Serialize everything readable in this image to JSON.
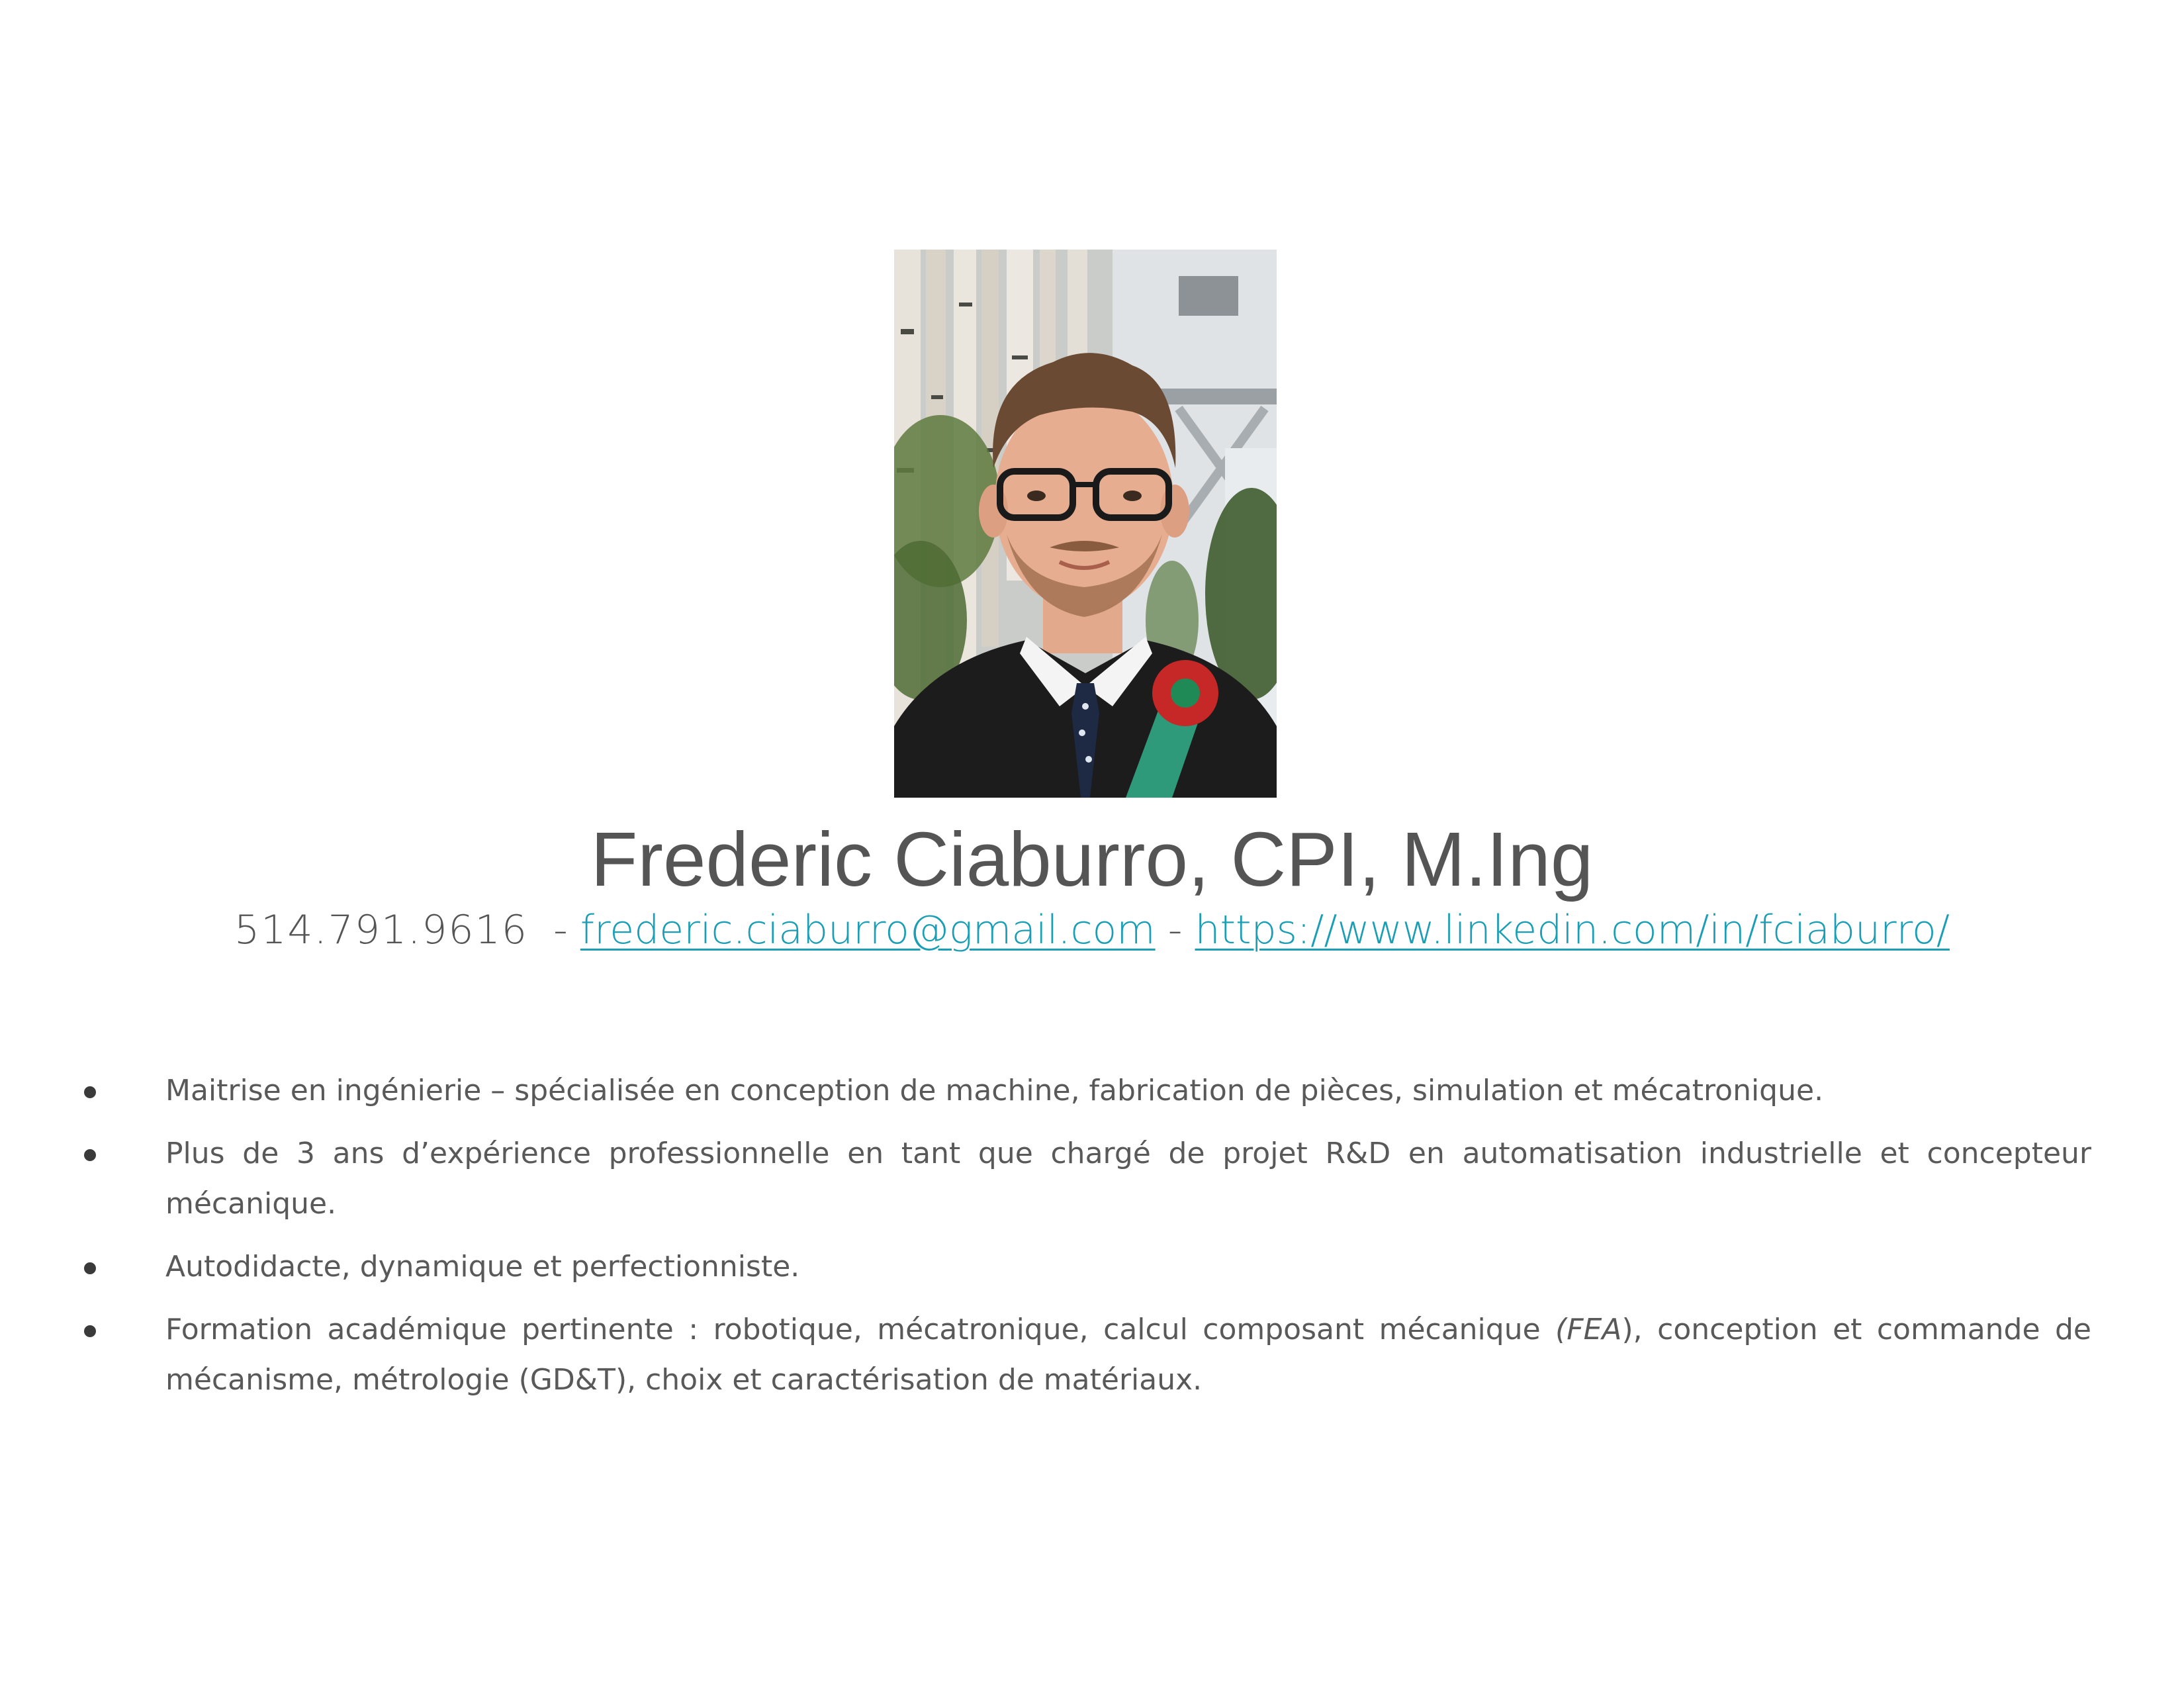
{
  "profile": {
    "name": "Frederic Ciaburro, CPI, M.Ing",
    "phone": "514.791.9616",
    "separator": "-",
    "email": "frederic.ciaburro@gmail.com",
    "linkedin": "https://www.linkedin.com/in/fciaburro/"
  },
  "bullets": [
    {
      "text": "Maitrise en ingénierie – spécialisée en conception de machine, fabrication de pièces, simulation et mécatronique."
    },
    {
      "text": "Plus de 3 ans d’expérience professionnelle en tant que chargé de projet R&D en automatisation industrielle et concepteur mécanique."
    },
    {
      "text": "Autodidacte, dynamique et perfectionniste."
    },
    {
      "before": "Formation académique pertinente : robotique, mécatronique, calcul composant mécanique ",
      "italic": "(FEA",
      "after": "), conception et commande de mécanisme, métrologie (GD&T), choix et caractérisation de matériaux."
    }
  ],
  "colors": {
    "text": "#595959",
    "link": "#1a9eb5",
    "gown": "#1c1c1c",
    "sash": "#2f9a7a",
    "rosette": "#c62828"
  }
}
